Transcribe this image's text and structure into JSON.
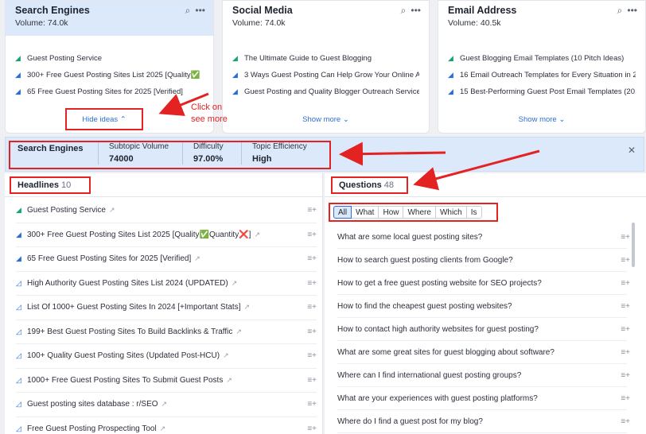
{
  "cards": [
    {
      "title": "Search Engines",
      "volume": "Volume: 74.0k",
      "items": [
        {
          "icon": "megaphone-icon",
          "text": "Guest Posting Service"
        },
        {
          "icon": "bullhorn-icon",
          "text": "300+ Free Guest Posting Sites List 2025 [Quality✅"
        },
        {
          "icon": "bullhorn-icon",
          "text": "65 Free Guest Posting Sites for 2025 [Verified]"
        }
      ],
      "footer": "Hide ideas ⌃"
    },
    {
      "title": "Social Media",
      "volume": "Volume: 74.0k",
      "items": [
        {
          "icon": "megaphone-icon",
          "text": "The Ultimate Guide to Guest Blogging"
        },
        {
          "icon": "bullhorn-icon",
          "text": "3 Ways Guest Posting Can Help Grow Your Online Au..."
        },
        {
          "icon": "bullhorn-icon",
          "text": "Guest Posting and Quality Blogger Outreach Services"
        }
      ],
      "footer": "Show more ⌄"
    },
    {
      "title": "Email Address",
      "volume": "Volume: 40.5k",
      "items": [
        {
          "icon": "megaphone-icon",
          "text": "Guest Blogging Email Templates (10 Pitch Ideas)"
        },
        {
          "icon": "bullhorn-icon",
          "text": "16 Email Outreach Templates for Every Situation in 2..."
        },
        {
          "icon": "bullhorn-icon",
          "text": "15 Best-Performing Guest Post Email Templates (20..."
        }
      ],
      "footer": "Show more ⌄"
    }
  ],
  "annotation": {
    "line1": "Click on",
    "line2": "see more"
  },
  "metrics": {
    "name": "Search Engines",
    "subtopic_volume_label": "Subtopic Volume",
    "subtopic_volume": "74000",
    "difficulty_label": "Difficulty",
    "difficulty": "97.00%",
    "efficiency_label": "Topic Efficiency",
    "efficiency": "High"
  },
  "headlines": {
    "title": "Headlines",
    "count": "10",
    "items": [
      {
        "icon": "megaphone-icon",
        "text": "Guest Posting Service"
      },
      {
        "icon": "bullhorn-icon",
        "text": "300+ Free Guest Posting Sites List 2025 [Quality✅Quantity❌]"
      },
      {
        "icon": "bullhorn-icon",
        "text": "65 Free Guest Posting Sites for 2025 [Verified]"
      },
      {
        "icon": "bullhorn-outline-icon",
        "text": "High Authority Guest Posting Sites List 2024 (UPDATED)"
      },
      {
        "icon": "bullhorn-outline-icon",
        "text": "List Of 1000+ Guest Posting Sites In 2024 [+Important Stats]"
      },
      {
        "icon": "bullhorn-outline-icon",
        "text": "199+ Best Guest Posting Sites To Build Backlinks & Traffic"
      },
      {
        "icon": "bullhorn-outline-icon",
        "text": "100+ Quality Guest Posting Sites (Updated Post-HCU)"
      },
      {
        "icon": "bullhorn-outline-icon",
        "text": "1000+ Free Guest Posting Sites To Submit Guest Posts"
      },
      {
        "icon": "bullhorn-outline-icon",
        "text": "Guest posting sites database : r/SEO"
      },
      {
        "icon": "bullhorn-outline-icon",
        "text": "Free Guest Posting Prospecting Tool"
      }
    ]
  },
  "questions": {
    "title": "Questions",
    "count": "48",
    "filters": [
      "All",
      "What",
      "How",
      "Where",
      "Which",
      "Is"
    ],
    "active_filter": "All",
    "items": [
      "What are some local guest posting sites?",
      "How to search guest posting clients from Google?",
      "How to get a free guest posting website for SEO projects?",
      "How to find the cheapest guest posting websites?",
      "How to contact high authority websites for guest posting?",
      "What are some great sites for guest blogging about software?",
      "Where can I find international guest posting groups?",
      "What are your experiences with guest posting platforms?",
      "Where do I find a guest post for my blog?"
    ]
  },
  "colors": {
    "accent": "#2b6fd6",
    "highlight": "#dbe9fa",
    "annotation": "#e32222",
    "green": "#16a37a"
  }
}
